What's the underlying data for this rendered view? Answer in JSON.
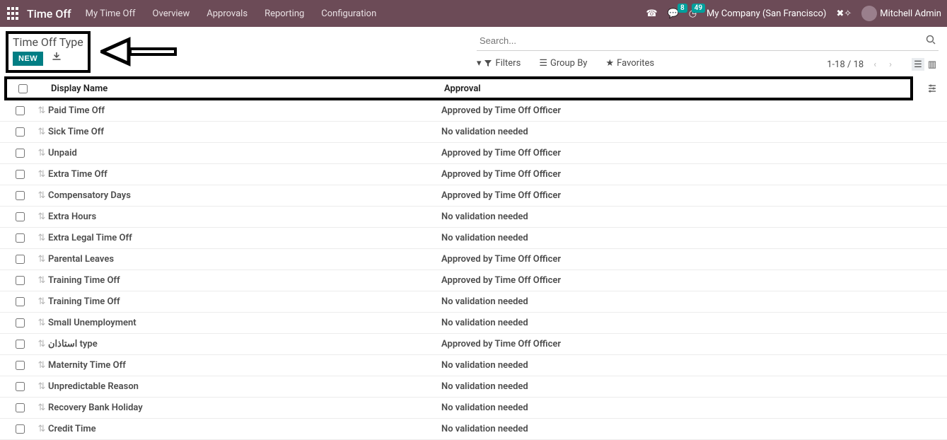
{
  "topnav": {
    "brand": "Time Off",
    "items": [
      "My Time Off",
      "Overview",
      "Approvals",
      "Reporting",
      "Configuration"
    ],
    "msg_badge": "8",
    "clock_badge": "49",
    "company": "My Company (San Francisco)",
    "user": "Mitchell Admin"
  },
  "toolbar": {
    "breadcrumb": "Time Off Type",
    "new_label": "NEW",
    "search_placeholder": "Search...",
    "filters": "Filters",
    "groupby": "Group By",
    "favorites": "Favorites",
    "pager": "1-18 / 18"
  },
  "table": {
    "header_name": "Display Name",
    "header_approval": "Approval",
    "rows": [
      {
        "name": "Paid Time Off",
        "approval": "Approved by Time Off Officer"
      },
      {
        "name": "Sick Time Off",
        "approval": "No validation needed"
      },
      {
        "name": "Unpaid",
        "approval": "Approved by Time Off Officer"
      },
      {
        "name": "Extra Time Off",
        "approval": "Approved by Time Off Officer"
      },
      {
        "name": "Compensatory Days",
        "approval": "Approved by Time Off Officer"
      },
      {
        "name": "Extra Hours",
        "approval": "No validation needed"
      },
      {
        "name": "Extra Legal Time Off",
        "approval": "No validation needed"
      },
      {
        "name": "Parental Leaves",
        "approval": "Approved by Time Off Officer"
      },
      {
        "name": "Training Time Off",
        "approval": "Approved by Time Off Officer"
      },
      {
        "name": "Training Time Off",
        "approval": "No validation needed"
      },
      {
        "name": "Small Unemployment",
        "approval": "No validation needed"
      },
      {
        "name": "استاذان type",
        "approval": "Approved by Time Off Officer"
      },
      {
        "name": "Maternity Time Off",
        "approval": "No validation needed"
      },
      {
        "name": "Unpredictable Reason",
        "approval": "No validation needed"
      },
      {
        "name": "Recovery Bank Holiday",
        "approval": "No validation needed"
      },
      {
        "name": "Credit Time",
        "approval": "No validation needed"
      }
    ]
  }
}
